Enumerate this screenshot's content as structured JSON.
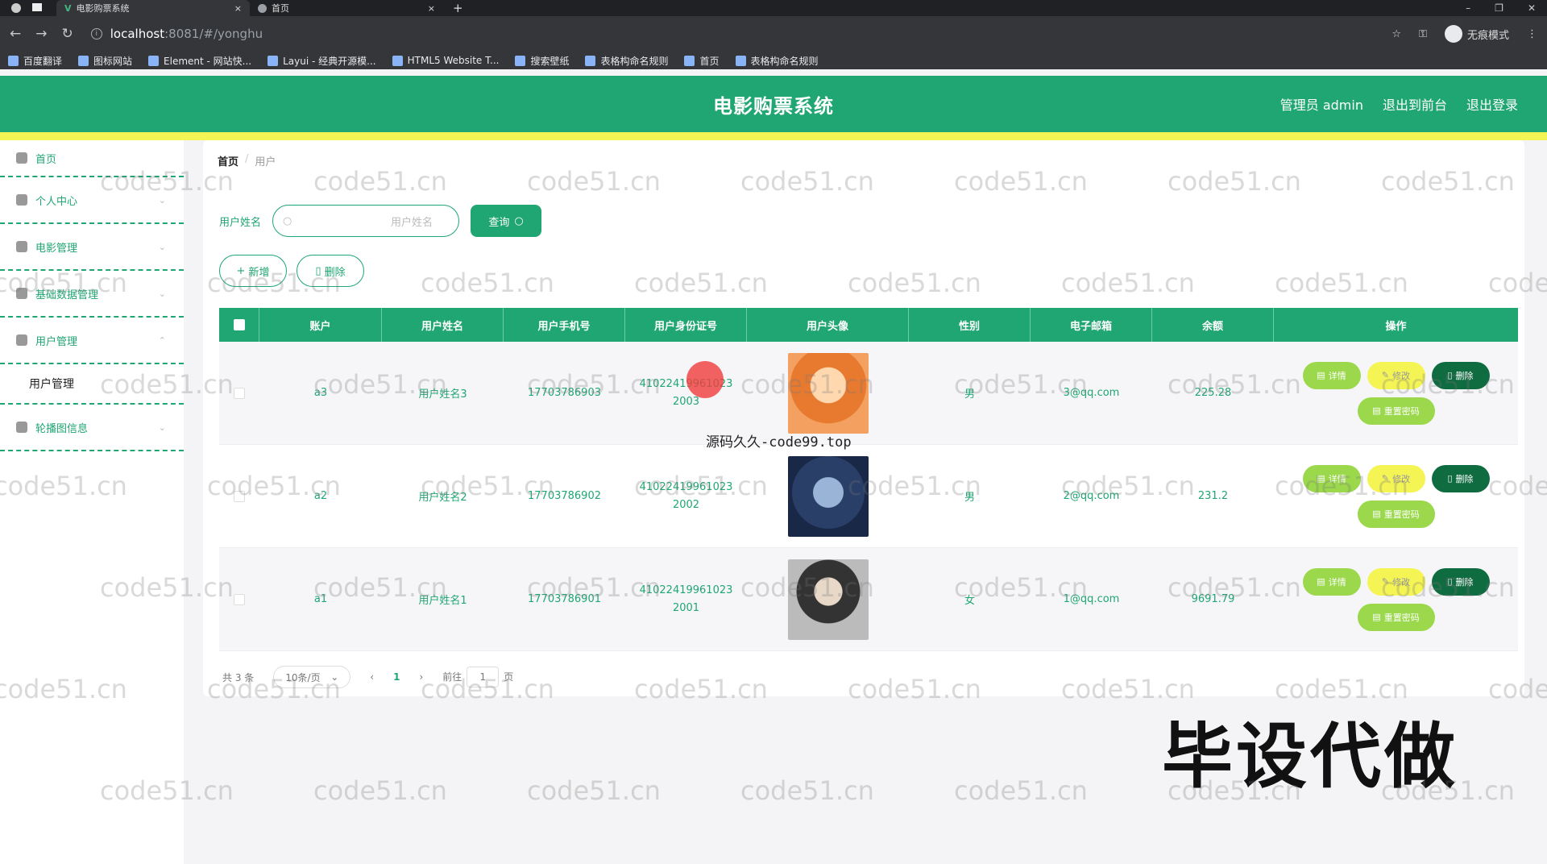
{
  "browser": {
    "tabs": [
      {
        "title": "电影购票系统",
        "close": "×"
      },
      {
        "title": "首页",
        "close": "×"
      }
    ],
    "new_tab": "+",
    "url_host": "localhost",
    "url_path": ":8081/#/yonghu",
    "incognito_label": "无痕模式",
    "bookmarks": [
      "百度翻译",
      "图标网站",
      "Element - 网站快...",
      "Layui - 经典开源模...",
      "HTML5 Website T...",
      "搜索壁纸",
      "表格构命名规则",
      "首页",
      "表格构命名规则"
    ]
  },
  "header": {
    "title": "电影购票系统",
    "admin_label": "管理员 admin",
    "back_front": "退出到前台",
    "logout": "退出登录"
  },
  "sidebar": {
    "items": [
      {
        "label": "首页"
      },
      {
        "label": "个人中心"
      },
      {
        "label": "电影管理"
      },
      {
        "label": "基础数据管理"
      },
      {
        "label": "用户管理"
      },
      {
        "label": "轮播图信息"
      }
    ],
    "submenu_user": "用户管理"
  },
  "breadcrumb": {
    "home": "首页",
    "sep": "/",
    "current": "用户"
  },
  "search": {
    "label": "用户姓名",
    "placeholder": "用户姓名",
    "button": "查询"
  },
  "actions": {
    "add": "新增",
    "delete": "删除"
  },
  "table": {
    "headers": [
      "账户",
      "用户姓名",
      "用户手机号",
      "用户身份证号",
      "用户头像",
      "性别",
      "电子邮箱",
      "余额",
      "操作"
    ],
    "rows": [
      {
        "account": "a3",
        "name": "用户姓名3",
        "phone": "17703786903",
        "id_card": "410224199610232003",
        "gender": "男",
        "email": "3@qq.com",
        "balance": "225.28"
      },
      {
        "account": "a2",
        "name": "用户姓名2",
        "phone": "17703786902",
        "id_card": "410224199610232002",
        "gender": "男",
        "email": "2@qq.com",
        "balance": "231.2"
      },
      {
        "account": "a1",
        "name": "用户姓名1",
        "phone": "17703786901",
        "id_card": "410224199610232001",
        "gender": "女",
        "email": "1@qq.com",
        "balance": "9691.79"
      }
    ],
    "ops": {
      "detail": "详情",
      "edit": "修改",
      "delete": "删除",
      "reset": "重置密码"
    }
  },
  "pagination": {
    "total": "共 3 条",
    "page_size": "10条/页",
    "prev": "‹",
    "page": "1",
    "next": "›",
    "goto_prefix": "前往",
    "goto_value": "1",
    "goto_suffix": "页"
  },
  "overlays": {
    "site_mark": "源码久久-code99.top",
    "big_mark": "毕设代做",
    "repeat_mark": "code51.cn"
  },
  "colors": {
    "primary": "#1fa672",
    "accent_yellow": "#f4f454",
    "dark_green": "#0f6b40",
    "light_green": "#9bd84c"
  }
}
